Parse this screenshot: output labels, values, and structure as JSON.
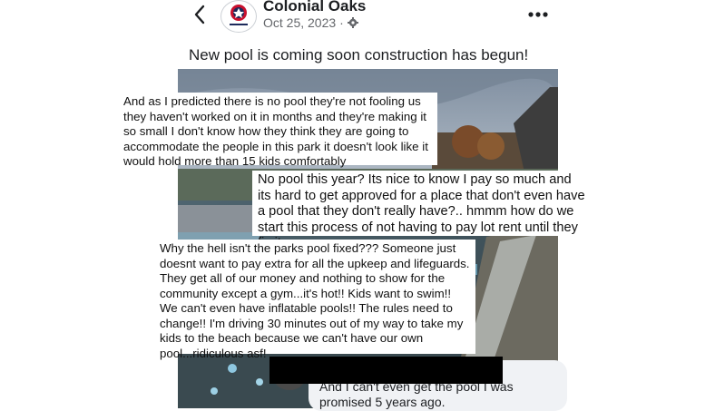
{
  "header": {
    "page_name": "Colonial Oaks",
    "date": "Oct 25, 2023",
    "separator": "·",
    "privacy_icon": "gear-icon",
    "back_icon": "chevron-left-icon",
    "more_icon": "more-horizontal-icon"
  },
  "post": {
    "text": "New pool is coming soon construction has begun!"
  },
  "captions": [
    "And as I predicted there is no pool they're not fooling us they haven't worked on it in months and they're making it so small I don't know how they think they are going to accommodate the people in this park it doesn't look like it would hold more than 15 kids comfortably",
    "No pool this year? Its nice to know I pay so much and its hard to get approved for a place that don't even have a pool that they don't really have?.. hmmm how do we start this process of not having to pay lot rent until they fix it...",
    "Why the hell isn't the parks pool fixed??? Someone just doesnt want to pay extra for all the upkeep and lifeguards. They get all of our money and nothing to show for the community except a gym...it's hot!! Kids want to swim!! We can't even have inflatable pools!! The rules need to change!! I'm driving 30 minutes out of my way to take my kids to the beach because we can't have our own pool...ridiculous asf!"
  ],
  "comment": {
    "text": "And I can't even get the pool I was promised 5 years ago."
  },
  "colors": {
    "text": "#1c1e21",
    "meta": "#65676b",
    "comment_bg": "#f0f2f5",
    "brand_red": "#c8102e",
    "brand_navy": "#1d2a5b"
  }
}
